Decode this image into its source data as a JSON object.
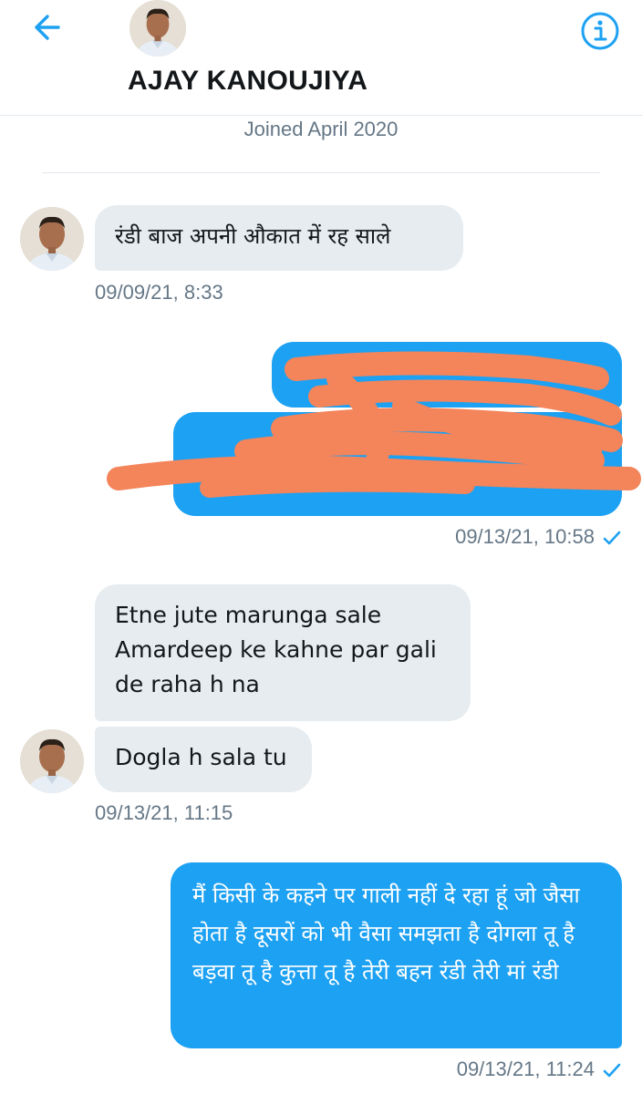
{
  "header": {
    "name": "AJAY KANOUJIYA",
    "joined": "Joined April 2020",
    "back_icon": "arrow-left-icon",
    "info_icon": "info-icon",
    "accent_color": "#1da1f2"
  },
  "messages": [
    {
      "direction": "received",
      "text": "रंडी बाज अपनी औकात में रह साले",
      "timestamp": "09/09/21, 8:33"
    },
    {
      "direction": "sent",
      "text_redacted": true,
      "timestamp": "09/13/21, 10:58"
    },
    {
      "direction": "received",
      "text": "Etne jute marunga sale Amardeep ke kahne par gali de raha h na"
    },
    {
      "direction": "received",
      "text": "Dogla h sala tu",
      "timestamp": "09/13/21, 11:15"
    },
    {
      "direction": "sent",
      "text": "मैं किसी के कहने पर गाली नहीं दे रहा हूं जो जैसा होता है दूसरों को भी वैसा समझता है दोगला तू है बड़वा तू है कुत्ता तू है तेरी बहन रंडी तेरी मां रंडी",
      "timestamp": "09/13/21, 11:24"
    }
  ],
  "colors": {
    "sent_bubble": "#1da1f2",
    "received_bubble": "#e6ecf0",
    "redaction": "#f4845a",
    "timestamp": "#657786"
  }
}
